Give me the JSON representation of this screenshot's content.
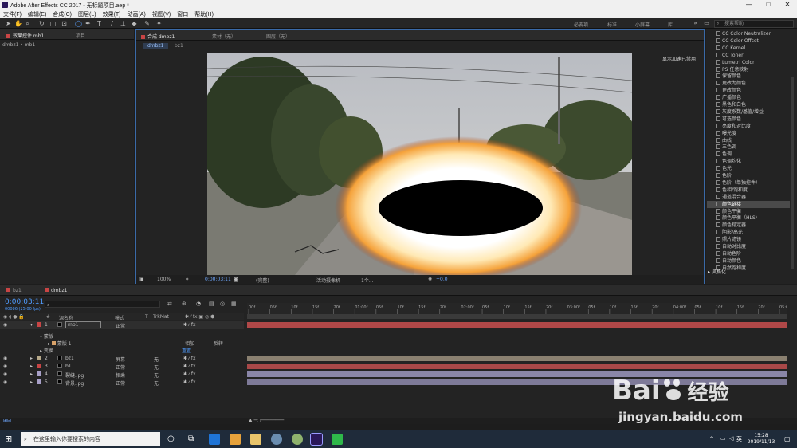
{
  "window": {
    "title": "Adobe After Effects CC 2017 - 无标题项目.aep *",
    "minimize": "—",
    "maximize": "□",
    "close": "✕"
  },
  "menu": [
    "文件(F)",
    "编辑(E)",
    "合成(C)",
    "图层(L)",
    "效果(T)",
    "动画(A)",
    "视图(V)",
    "窗口",
    "帮助(H)"
  ],
  "toolbar": {
    "workspaces": [
      "必要项",
      "标准",
      "小屏幕",
      "库"
    ],
    "search_placeholder": "搜索帮助"
  },
  "left_panel": {
    "tab_effects": "效果控件 mb1",
    "tab_project": "项目",
    "breadcrumb": "dmbz1 • mb1"
  },
  "comp_panel": {
    "tab_comp": "合成 dmbz1",
    "tab_footage": "素材（无）",
    "tab_layer": "图层（无）",
    "subtabs": [
      "dmbz1",
      "bz1"
    ],
    "gpu_note": "显示加速已禁用",
    "zoom": "100%",
    "timecode": "0:00:03:11",
    "resolution": "(完整)",
    "camera": "活动摄像机",
    "views": "1个...",
    "exposure": "+0.0"
  },
  "effects_list": {
    "items": [
      "CC Color Neutralizer",
      "CC Color Offset",
      "CC Kernel",
      "CC Toner",
      "Lumetri Color",
      "PS 任意映射",
      "保留颜色",
      "更改为颜色",
      "更改颜色",
      "广播颜色",
      "黑色和白色",
      "灰度系数/基值/增益",
      "可选颜色",
      "亮度和对比度",
      "曝光度",
      "曲线",
      "三色调",
      "色调",
      "色调均化",
      "色光",
      "色阶",
      "色阶（单独控件）",
      "色相/饱和度",
      "通道混合器",
      "颜色链接",
      "颜色平衡",
      "颜色平衡（HLS）",
      "颜色稳定器",
      "阴影/高光",
      "照片滤镜",
      "自动对比度",
      "自动色阶",
      "自动颜色",
      "自然饱和度"
    ],
    "selected_index": 24,
    "category_footer": "风格化"
  },
  "timeline": {
    "tabs": [
      "bz1",
      "dmbz1"
    ],
    "timecode": "0:00:03:11",
    "timecode_sub": "00086 (25.00 fps)",
    "columns": {
      "num": "#",
      "name": "源名称",
      "mode": "模式",
      "t": "T",
      "trkmat": "TrkMat"
    },
    "layers": [
      {
        "num": "1",
        "name": "mb1",
        "mode": "正常",
        "trkmat": "",
        "color": "#c84545",
        "track": "#b04848"
      },
      {
        "num": "2",
        "name": "bz1",
        "mode": "屏幕",
        "trkmat": "无",
        "color": "#b7a98a",
        "track": "#8a8070"
      },
      {
        "num": "3",
        "name": "b1",
        "mode": "正常",
        "trkmat": "无",
        "color": "#c84545",
        "track": "#a84848"
      },
      {
        "num": "4",
        "name": "裂缝.jpg",
        "mode": "相乘",
        "trkmat": "无",
        "color": "#a8a0c8",
        "track": "#8a86a8"
      },
      {
        "num": "5",
        "name": "背景.jpg",
        "mode": "正常",
        "trkmat": "无",
        "color": "#a8a0c8",
        "track": "#7e7a98"
      }
    ],
    "mask_group": "蒙版",
    "mask_name": "蒙版 1",
    "mask_mode": "相加",
    "mask_inverted": "反转",
    "transform": "变换",
    "reset": "重置",
    "ruler_labels": [
      "00f",
      "05f",
      "10f",
      "15f",
      "20f",
      "01:00f",
      "05f",
      "10f",
      "15f",
      "20f",
      "02:00f",
      "05f",
      "10f",
      "15f",
      "20f",
      "03:00f",
      "05f",
      "10f",
      "15f",
      "20f",
      "04:00f",
      "05f",
      "10f",
      "15f",
      "20f",
      "05:0"
    ],
    "playhead_fraction": 0.686
  },
  "taskbar": {
    "search": "在这里输入你要搜索的内容",
    "ime": "英",
    "time": "15:28",
    "date": "2019/11/13"
  },
  "watermark": {
    "brand": "Bai",
    "brand2": "经验",
    "url": "jingyan.baidu.com"
  }
}
